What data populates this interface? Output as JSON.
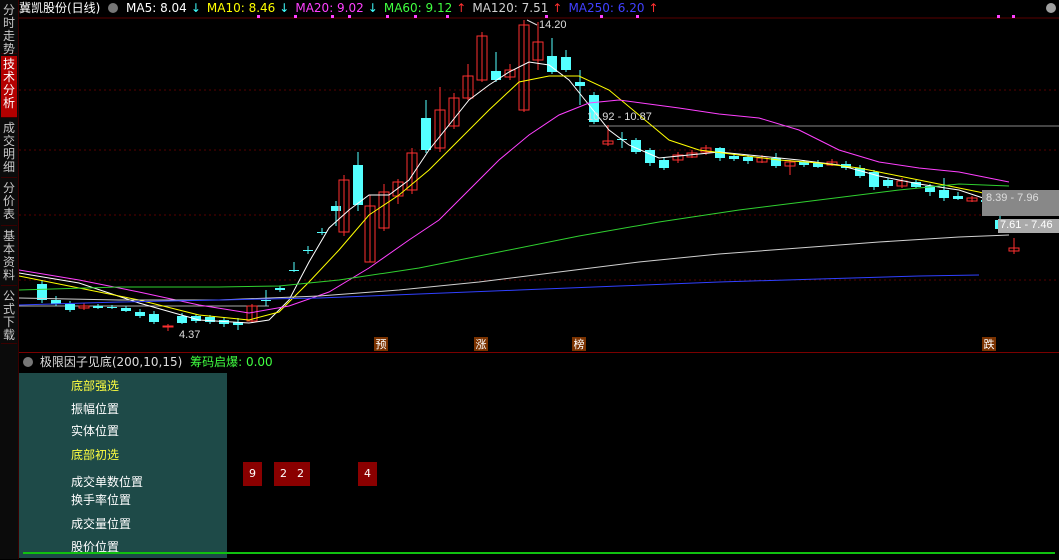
{
  "sidebar": {
    "tabs": [
      {
        "label": "分时走势",
        "active": false
      },
      {
        "label": "技术分析",
        "active": true
      },
      {
        "label": "成交明细",
        "active": false
      },
      {
        "label": "分价表",
        "active": false
      },
      {
        "label": "基本资料",
        "active": false
      },
      {
        "label": "公式下载",
        "active": false
      }
    ]
  },
  "header": {
    "stock": "冀凯股份(日线)",
    "ma": [
      {
        "label": "MA5: 8.04",
        "arrow": "↓",
        "color": "#ffffff"
      },
      {
        "label": "MA10: 8.46",
        "arrow": "↓",
        "color": "#ffff00"
      },
      {
        "label": "MA20: 9.02",
        "arrow": "↓",
        "color": "#ff40ff"
      },
      {
        "label": "MA60: 9.12",
        "arrow": "↑",
        "color": "#40ff40"
      },
      {
        "label": "MA120: 7.51",
        "arrow": "↑",
        "color": "#d0d0d0"
      },
      {
        "label": "MA250: 6.20",
        "arrow": "↑",
        "color": "#4040ff"
      }
    ]
  },
  "chart_data": {
    "type": "candlestick",
    "annotations": {
      "high": "14.20",
      "low": "4.37",
      "range1": "10.92 - 10.87",
      "range2": "8.39 - 7.96",
      "range3": "7.61 - 7.46"
    },
    "event_tags": [
      "预",
      "涨",
      "榜",
      "跌"
    ]
  },
  "indicator": {
    "title": "极限因子见底(200,10,15)",
    "subtitle": "筹码启爆: 0.00",
    "labels": [
      {
        "text": "底部强选",
        "yellow": true
      },
      {
        "text": "振幅位置",
        "yellow": false
      },
      {
        "text": "实体位置",
        "yellow": false
      },
      {
        "text": "底部初选",
        "yellow": true
      },
      {
        "text": "成交单数位置",
        "yellow": false
      },
      {
        "text": "换手率位置",
        "yellow": false
      },
      {
        "text": "成交量位置",
        "yellow": false
      },
      {
        "text": "股价位置",
        "yellow": false
      }
    ],
    "marks": [
      "9",
      "2",
      "2",
      "4"
    ]
  },
  "colors": {
    "up": "#ff3030",
    "down": "#54ffff",
    "bg": "#000000"
  }
}
